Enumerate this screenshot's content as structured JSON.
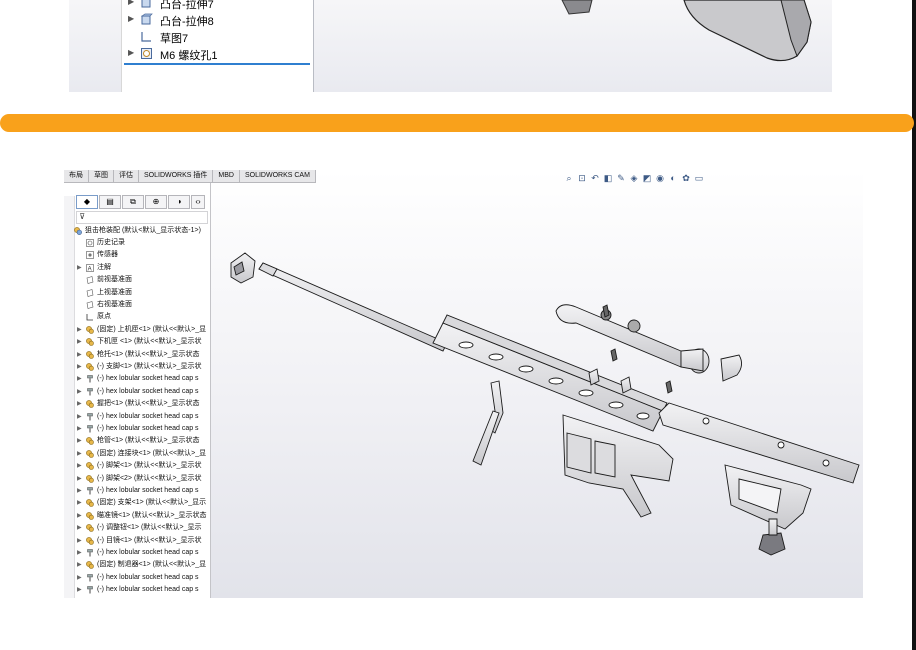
{
  "top_tree": {
    "items": [
      {
        "label": "凸台-拉伸7",
        "icon": "extrude-feature-icon",
        "has_arrow": true
      },
      {
        "label": "凸台-拉伸8",
        "icon": "extrude-feature-icon",
        "has_arrow": true
      },
      {
        "label": "草图7",
        "icon": "sketch-icon",
        "has_arrow": false
      },
      {
        "label": "M6 螺纹孔1",
        "icon": "hole-wizard-icon",
        "has_arrow": true
      }
    ]
  },
  "command_tabs": [
    "布局",
    "草图",
    "评估",
    "SOLIDWORKS 插件",
    "MBD",
    "SOLIDWORKS CAM"
  ],
  "feature_tree": {
    "root": "狙击枪装配 (默认<默认_显示状态-1>)",
    "items": [
      {
        "label": "历史记录",
        "icon": "history-icon",
        "arrow": false
      },
      {
        "label": "传感器",
        "icon": "sensor-icon",
        "arrow": false
      },
      {
        "label": "注解",
        "icon": "annotation-icon",
        "arrow": true
      },
      {
        "label": "前视基准面",
        "icon": "plane-icon",
        "arrow": false
      },
      {
        "label": "上视基准面",
        "icon": "plane-icon",
        "arrow": false
      },
      {
        "label": "右视基准面",
        "icon": "plane-icon",
        "arrow": false
      },
      {
        "label": "原点",
        "icon": "origin-icon",
        "arrow": false
      },
      {
        "label": "(固定) 上机匣<1> (默认<<默认>_显",
        "icon": "part-icon",
        "arrow": true
      },
      {
        "label": "下机匣 <1> (默认<<默认>_显示状",
        "icon": "part-icon",
        "arrow": true
      },
      {
        "label": "枪托<1> (默认<<默认>_显示状态",
        "icon": "part-icon",
        "arrow": true
      },
      {
        "label": "(-) 支脚<1> (默认<<默认>_显示状",
        "icon": "part-icon",
        "arrow": true
      },
      {
        "label": "(-) hex lobular socket head cap s",
        "icon": "screw-icon",
        "arrow": true
      },
      {
        "label": "(-) hex lobular socket head cap s",
        "icon": "screw-icon",
        "arrow": true
      },
      {
        "label": "握把<1> (默认<<默认>_显示状态",
        "icon": "part-icon",
        "arrow": true
      },
      {
        "label": "(-) hex lobular socket head cap s",
        "icon": "screw-icon",
        "arrow": true
      },
      {
        "label": "(-) hex lobular socket head cap s",
        "icon": "screw-icon",
        "arrow": true
      },
      {
        "label": "枪管<1> (默认<<默认>_显示状态",
        "icon": "part-icon",
        "arrow": true
      },
      {
        "label": "(固定) 连接块<1> (默认<<默认>_显",
        "icon": "part-icon",
        "arrow": true
      },
      {
        "label": "(-) 脚架<1> (默认<<默认>_显示状",
        "icon": "part-icon",
        "arrow": true
      },
      {
        "label": "(-) 脚架<2> (默认<<默认>_显示状",
        "icon": "part-icon",
        "arrow": true
      },
      {
        "label": "(-) hex lobular socket head cap s",
        "icon": "screw-icon",
        "arrow": true
      },
      {
        "label": "(固定) 支架<1> (默认<<默认>_显示",
        "icon": "part-icon",
        "arrow": true
      },
      {
        "label": "瞄准镜<1> (默认<<默认>_显示状态",
        "icon": "part-icon",
        "arrow": true
      },
      {
        "label": "(-) 调整钮<1> (默认<<默认>_显示",
        "icon": "part-icon",
        "arrow": true
      },
      {
        "label": "(-) 目镜<1> (默认<<默认>_显示状",
        "icon": "part-icon",
        "arrow": true
      },
      {
        "label": "(-) hex lobular socket head cap s",
        "icon": "screw-icon",
        "arrow": true
      },
      {
        "label": "(固定) 制退器<1> (默认<<默认>_显",
        "icon": "part-icon",
        "arrow": true
      },
      {
        "label": "(-) hex lobular socket head cap s",
        "icon": "screw-icon",
        "arrow": true
      },
      {
        "label": "(-) hex lobular socket head cap s",
        "icon": "screw-icon",
        "arrow": true
      }
    ]
  },
  "colors": {
    "accent_bar": "#f9a11b",
    "selection": "#2f7fd0",
    "part_icon": "#e8b84a"
  }
}
